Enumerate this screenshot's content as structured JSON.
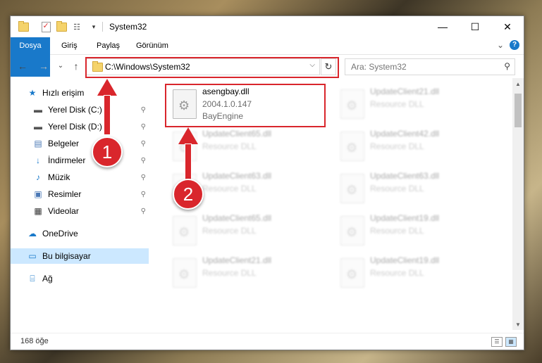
{
  "window": {
    "title": "System32",
    "minimize": "—",
    "maximize": "☐",
    "close": "✕"
  },
  "ribbon": {
    "tabs": [
      "Dosya",
      "Giriş",
      "Paylaş",
      "Görünüm"
    ],
    "expand": "⌄",
    "help": "?"
  },
  "nav": {
    "back": "←",
    "forward": "→",
    "recent": "⌄",
    "up": "↑",
    "address": "C:\\Windows\\System32",
    "address_dropdown": "⌵",
    "refresh": "↻",
    "search_placeholder": "Ara: System32",
    "search_icon": "⚲"
  },
  "sidebar": {
    "items": [
      {
        "label": "Hızlı erişim",
        "icon": "star-icon",
        "glyph": "★",
        "color": "#1979ca",
        "pinned": false
      },
      {
        "label": "Yerel Disk (C:)",
        "icon": "drive-icon",
        "glyph": "▬",
        "color": "#555555",
        "pinned": true
      },
      {
        "label": "Yerel Disk (D:)",
        "icon": "drive-icon",
        "glyph": "▬",
        "color": "#555555",
        "pinned": true
      },
      {
        "label": "Belgeler",
        "icon": "documents-icon",
        "glyph": "▤",
        "color": "#4a78b5",
        "pinned": true
      },
      {
        "label": "İndirmeler",
        "icon": "downloads-icon",
        "glyph": "↓",
        "color": "#1979ca",
        "pinned": true
      },
      {
        "label": "Müzik",
        "icon": "music-icon",
        "glyph": "♪",
        "color": "#1979ca",
        "pinned": true
      },
      {
        "label": "Resimler",
        "icon": "pictures-icon",
        "glyph": "▣",
        "color": "#4a78b5",
        "pinned": true
      },
      {
        "label": "Videolar",
        "icon": "videos-icon",
        "glyph": "▦",
        "color": "#333333",
        "pinned": true
      },
      {
        "label": "OneDrive",
        "icon": "onedrive-icon",
        "glyph": "☁",
        "color": "#1979ca",
        "pinned": false
      },
      {
        "label": "Bu bilgisayar",
        "icon": "computer-icon",
        "glyph": "▭",
        "color": "#1979ca",
        "pinned": false
      },
      {
        "label": "Ağ",
        "icon": "network-icon",
        "glyph": "⌸",
        "color": "#1979ca",
        "pinned": false
      }
    ],
    "pin_glyph": "📌"
  },
  "files": [
    {
      "name": "asengbay.dll",
      "version": "2004.1.0.147",
      "desc": "BayEngine"
    },
    {
      "name": "UpdateClient21.dll",
      "version": "Resource DLL",
      "desc": ""
    },
    {
      "name": "UpdateClient65.dll",
      "version": "Resource DLL",
      "desc": ""
    },
    {
      "name": "UpdateClient42.dll",
      "version": "Resource DLL",
      "desc": ""
    },
    {
      "name": "UpdateClient63.dll",
      "version": "Resource DLL",
      "desc": ""
    },
    {
      "name": "UpdateClient63.dll",
      "version": "Resource DLL",
      "desc": ""
    },
    {
      "name": "UpdateClient65.dll",
      "version": "Resource DLL",
      "desc": ""
    },
    {
      "name": "UpdateClient19.dll",
      "version": "Resource DLL",
      "desc": ""
    },
    {
      "name": "UpdateClient21.dll",
      "version": "Resource DLL",
      "desc": ""
    },
    {
      "name": "UpdateClient19.dll",
      "version": "Resource DLL",
      "desc": ""
    }
  ],
  "status": {
    "count": "168 öğe"
  },
  "callouts": [
    "1",
    "2"
  ],
  "colors": {
    "accent": "#1979ca",
    "highlight": "#d9262c"
  }
}
